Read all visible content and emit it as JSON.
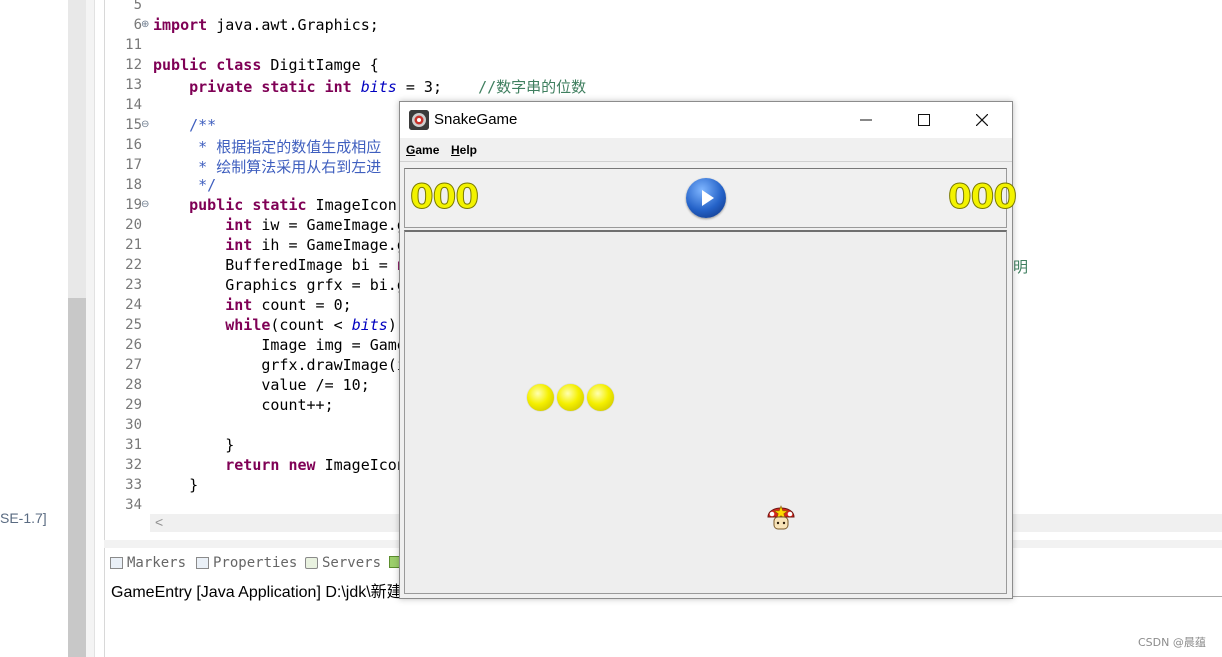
{
  "left_panel": {
    "fragment": "SE-1.7]"
  },
  "editor": {
    "lines": [
      {
        "n": "5",
        "fold": "",
        "html": ""
      },
      {
        "n": "6",
        "fold": "⊕",
        "html": "<span class='kw'>import</span> java.awt.Graphics;"
      },
      {
        "n": "11",
        "fold": "",
        "html": ""
      },
      {
        "n": "12",
        "fold": "",
        "html": "<span class='kw'>public</span> <span class='kw'>class</span> DigitIamge {"
      },
      {
        "n": "13",
        "fold": "",
        "html": "    <span class='kw'>private</span> <span class='kw'>static</span> <span class='kw'>int</span> <span class='fld'>bits</span> = 3;    <span class='cmt'>//数字串的位数</span>"
      },
      {
        "n": "14",
        "fold": "",
        "html": ""
      },
      {
        "n": "15",
        "fold": "⊖",
        "html": "    <span class='doc'>/**</span>"
      },
      {
        "n": "16",
        "fold": "",
        "html": "<span class='doc'>     * 根据指定的数值生成相应</span>"
      },
      {
        "n": "17",
        "fold": "",
        "html": "<span class='doc'>     * 绘制算法采用从右到左进</span>"
      },
      {
        "n": "18",
        "fold": "",
        "html": "<span class='doc'>     */</span>"
      },
      {
        "n": "19",
        "fold": "⊖",
        "html": "    <span class='kw'>public</span> <span class='kw'>static</span> ImageIcon"
      },
      {
        "n": "20",
        "fold": "",
        "html": "        <span class='kw'>int</span> iw = GameImage.g"
      },
      {
        "n": "21",
        "fold": "",
        "html": "        <span class='kw'>int</span> ih = GameImage.g"
      },
      {
        "n": "22",
        "fold": "",
        "html": "        BufferedImage bi = <span class='kw'>n</span>"
      },
      {
        "n": "23",
        "fold": "",
        "html": "        Graphics grfx = bi.g"
      },
      {
        "n": "24",
        "fold": "",
        "html": "        <span class='kw'>int</span> count = 0;"
      },
      {
        "n": "25",
        "fold": "",
        "html": "        <span class='kw'>while</span>(count &lt; <span class='fld'>bits</span>)"
      },
      {
        "n": "26",
        "fold": "",
        "html": "            Image img = Game"
      },
      {
        "n": "27",
        "fold": "",
        "html": "            grfx.drawImage(i"
      },
      {
        "n": "28",
        "fold": "",
        "html": "            value /= 10;"
      },
      {
        "n": "29",
        "fold": "",
        "html": "            count++;"
      },
      {
        "n": "30",
        "fold": "",
        "html": ""
      },
      {
        "n": "31",
        "fold": "",
        "html": "        }"
      },
      {
        "n": "32",
        "fold": "",
        "html": "        <span class='kw'>return</span> <span class='kw'>new</span> ImageIcon"
      },
      {
        "n": "33",
        "fold": "",
        "html": "    }"
      },
      {
        "n": "34",
        "fold": "",
        "html": ""
      }
    ],
    "overflow_text": "明",
    "hscroll_arrow": "<"
  },
  "console": {
    "tabs": [
      "Markers",
      "Properties",
      "Servers"
    ],
    "line": "GameEntry [Java Application] D:\\jdk\\新建"
  },
  "game": {
    "title": "SnakeGame",
    "menus": [
      "Game",
      "Help"
    ],
    "score_left": "000",
    "score_right": "000",
    "snake_segments": 3,
    "icons": {
      "app": "snake-app-icon",
      "play": "play-icon",
      "food": "mushroom-icon"
    }
  },
  "watermark": "CSDN @晨蕴"
}
